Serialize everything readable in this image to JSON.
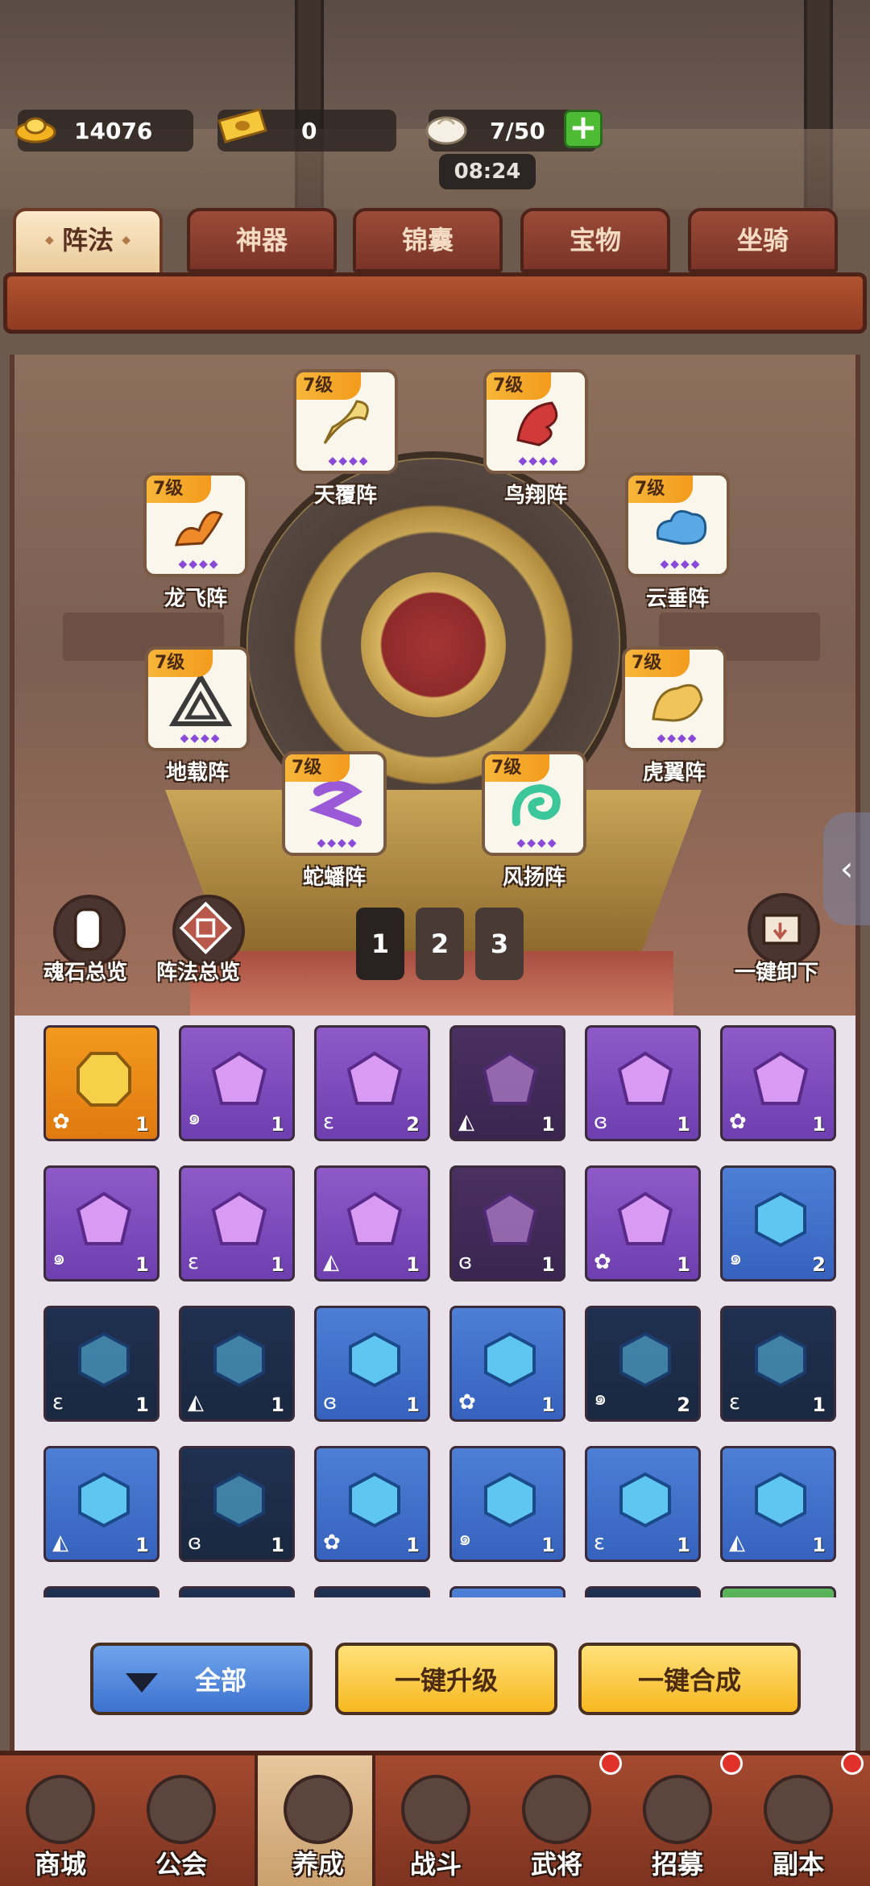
{
  "resources": {
    "gold": "14076",
    "ticket": "0",
    "stamina": "7/50",
    "timer": "08:24"
  },
  "tabs": [
    {
      "label": "阵法",
      "active": true
    },
    {
      "label": "神器",
      "active": false
    },
    {
      "label": "锦囊",
      "active": false
    },
    {
      "label": "宝物",
      "active": false
    },
    {
      "label": "坐骑",
      "active": false
    }
  ],
  "formations": [
    {
      "level": "7级",
      "name": "天覆阵",
      "icon": "crane-icon",
      "color": "#f2d77a"
    },
    {
      "level": "7级",
      "name": "鸟翔阵",
      "icon": "phoenix-icon",
      "color": "#d23a3a"
    },
    {
      "level": "7级",
      "name": "龙飞阵",
      "icon": "dragon-icon",
      "color": "#ee8a2a"
    },
    {
      "level": "7级",
      "name": "云垂阵",
      "icon": "cloud-icon",
      "color": "#5aa9e6"
    },
    {
      "level": "7级",
      "name": "地载阵",
      "icon": "triangle-icon",
      "color": "#4a4a4a"
    },
    {
      "level": "7级",
      "name": "虎翼阵",
      "icon": "tiger-icon",
      "color": "#f0c45a"
    },
    {
      "level": "7级",
      "name": "蛇蟠阵",
      "icon": "snake-icon",
      "color": "#9a5ad8"
    },
    {
      "level": "7级",
      "name": "风扬阵",
      "icon": "wind-icon",
      "color": "#3cc79a"
    }
  ],
  "tools": {
    "soulstone_overview": "魂石总览",
    "formation_overview": "阵法总览",
    "unequip_all": "一键卸下"
  },
  "pages": [
    "1",
    "2",
    "3"
  ],
  "gems": [
    {
      "tier": "gold",
      "count": "1"
    },
    {
      "tier": "purple",
      "count": "1"
    },
    {
      "tier": "purple",
      "count": "2"
    },
    {
      "tier": "dpurple",
      "count": "1"
    },
    {
      "tier": "purple",
      "count": "1"
    },
    {
      "tier": "purple",
      "count": "1"
    },
    {
      "tier": "purple",
      "count": "1"
    },
    {
      "tier": "purple",
      "count": "1"
    },
    {
      "tier": "purple",
      "count": "1"
    },
    {
      "tier": "dpurple",
      "count": "1"
    },
    {
      "tier": "purple",
      "count": "1"
    },
    {
      "tier": "blue",
      "count": "2"
    },
    {
      "tier": "dblue",
      "count": "1"
    },
    {
      "tier": "dblue",
      "count": "1"
    },
    {
      "tier": "blue",
      "count": "1"
    },
    {
      "tier": "blue",
      "count": "1"
    },
    {
      "tier": "dblue",
      "count": "2"
    },
    {
      "tier": "dblue",
      "count": "1"
    },
    {
      "tier": "blue",
      "count": "1"
    },
    {
      "tier": "dblue",
      "count": "1"
    },
    {
      "tier": "blue",
      "count": "1"
    },
    {
      "tier": "blue",
      "count": "1"
    },
    {
      "tier": "blue",
      "count": "1"
    },
    {
      "tier": "blue",
      "count": "1"
    }
  ],
  "actions": {
    "all": "全部",
    "upgrade_all": "一键升级",
    "merge_all": "一键合成"
  },
  "nav": [
    {
      "label": "商城",
      "dot": false,
      "active": false
    },
    {
      "label": "公会",
      "dot": false,
      "active": false
    },
    {
      "label": "养成",
      "dot": false,
      "active": true
    },
    {
      "label": "战斗",
      "dot": false,
      "active": false
    },
    {
      "label": "武将",
      "dot": true,
      "active": false
    },
    {
      "label": "招募",
      "dot": true,
      "active": false
    },
    {
      "label": "副本",
      "dot": true,
      "active": false
    }
  ],
  "colors": {
    "accent_gold": "#f7b820",
    "accent_blue": "#3d72cf",
    "nav_bg": "#a44a30"
  }
}
